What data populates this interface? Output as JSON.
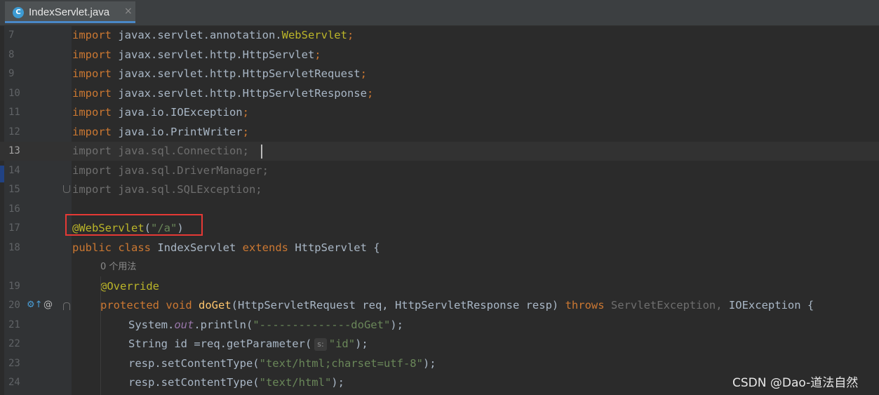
{
  "tab": {
    "icon": "C",
    "icon_name": "java-class-icon",
    "title": "IndexServlet.java",
    "close": "×"
  },
  "colors": {
    "background": "#2b2b2b",
    "keyword": "#cc7832",
    "annotation": "#bbb529",
    "string": "#6a8759",
    "unused_import": "#6e6e6e",
    "highlight_box": "#e53935"
  },
  "lines": [
    {
      "num": "7"
    },
    {
      "num": "8"
    },
    {
      "num": "9"
    },
    {
      "num": "10"
    },
    {
      "num": "11"
    },
    {
      "num": "12"
    },
    {
      "num": "13"
    },
    {
      "num": "14"
    },
    {
      "num": "15"
    },
    {
      "num": "16"
    },
    {
      "num": "17"
    },
    {
      "num": "18"
    },
    {
      "num": ""
    },
    {
      "num": "19"
    },
    {
      "num": "20"
    },
    {
      "num": "21"
    },
    {
      "num": "22"
    },
    {
      "num": "23"
    },
    {
      "num": "24"
    }
  ],
  "code": {
    "l7": {
      "kw": "import",
      "path": " javax.servlet.annotation.",
      "cls": "WebServlet",
      "semi": ";"
    },
    "l8": {
      "kw": "import",
      "path": " javax.servlet.http.HttpServlet",
      "semi": ";"
    },
    "l9": {
      "kw": "import",
      "path": " javax.servlet.http.HttpServletRequest",
      "semi": ";"
    },
    "l10": {
      "kw": "import",
      "path": " javax.servlet.http.HttpServletResponse",
      "semi": ";"
    },
    "l11": {
      "kw": "import",
      "path": " java.io.IOException",
      "semi": ";"
    },
    "l12": {
      "kw": "import",
      "path": " java.io.PrintWriter",
      "semi": ";"
    },
    "l13": "import java.sql.Connection;",
    "l14": "import java.sql.DriverManager;",
    "l15": "import java.sql.SQLException;",
    "l17": {
      "ann": "@WebServlet",
      "open": "(",
      "str": "\"/a\"",
      "close": ")"
    },
    "l18": {
      "kw1": "public",
      "kw2": " class",
      "name": " IndexServlet",
      "kw3": " extends",
      "rest": " HttpServlet {"
    },
    "usage_hint": "0 个用法",
    "l19": "@Override",
    "l20": {
      "kw1": "protected",
      "kw2": " void",
      "meth": " doGet",
      "params": "(HttpServletRequest req, HttpServletResponse resp) ",
      "kw3": "throws",
      "unused": " ServletException,",
      "rest": " IOException {"
    },
    "l21": {
      "a": "System.",
      "field": "out",
      "b": ".println(",
      "str": "\"--------------doGet\"",
      "c": ");"
    },
    "l22": {
      "a": "String id =req.getParameter(",
      "hint": "s:",
      "str": "\"id\"",
      "c": ");"
    },
    "l23": {
      "a": "resp.setContentType(",
      "str": "\"text/html;charset=utf-8\"",
      "c": ");"
    },
    "l24": {
      "a": "resp.setContentType(",
      "str": "\"text/html\"",
      "c": ");"
    }
  },
  "gutter_icons": {
    "override": "⚙↑",
    "override_name": "overrides-method-icon",
    "annotation": "@",
    "annotation_name": "annotation-marker-icon"
  },
  "watermark": "CSDN @Dao-道法自然"
}
